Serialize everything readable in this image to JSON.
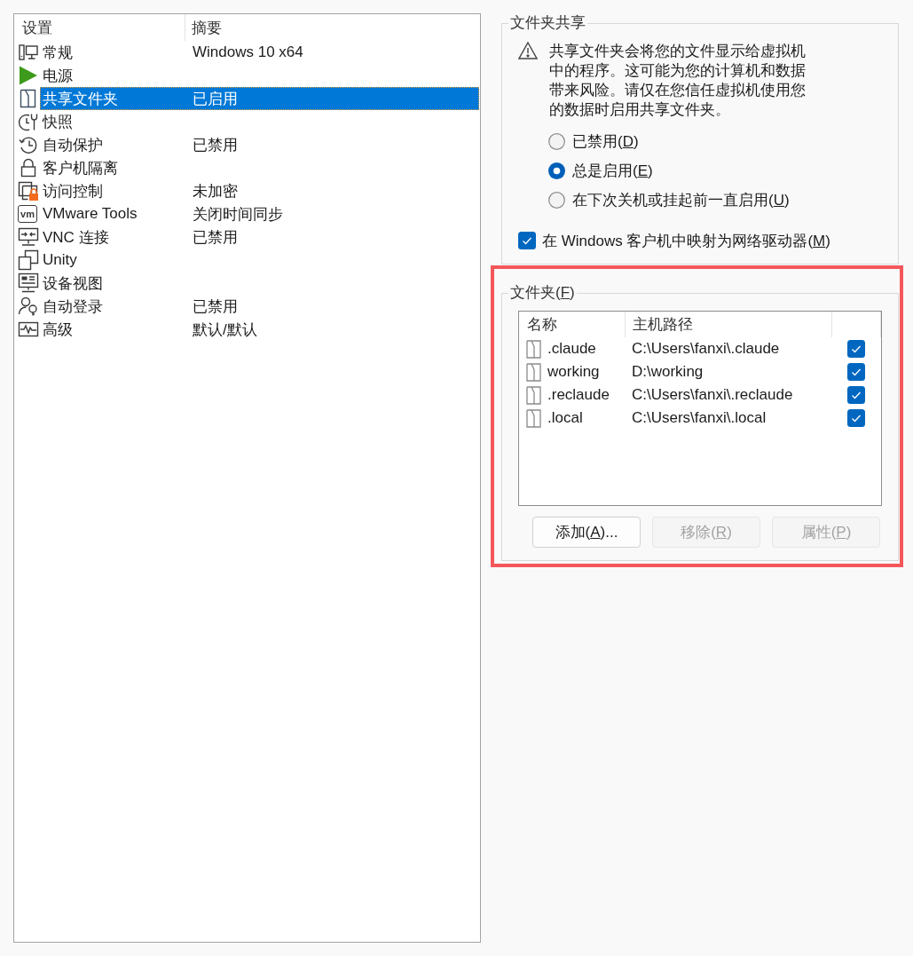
{
  "settings_list": {
    "columns": [
      "设置",
      "摘要"
    ],
    "items": [
      {
        "kind": "monitor",
        "name": "常规",
        "summary": "Windows 10 x64",
        "selected": false
      },
      {
        "kind": "play",
        "name": "电源",
        "selected": false
      },
      {
        "kind": "shared-folder",
        "name": "共享文件夹",
        "summary": "已启用",
        "selected": true
      },
      {
        "kind": "snapshot",
        "name": "快照",
        "selected": false
      },
      {
        "kind": "history",
        "name": "自动保护",
        "summary": "已禁用",
        "selected": false
      },
      {
        "kind": "padlock",
        "name": "客户机隔离",
        "selected": false
      },
      {
        "kind": "access-lock",
        "name": "访问控制",
        "summary": "未加密",
        "selected": false
      },
      {
        "kind": "badge",
        "badge": "vm",
        "name": "VMware Tools",
        "summary": "关闭时间同步",
        "selected": false
      },
      {
        "kind": "vnc",
        "name": "VNC 连接",
        "summary": "已禁用",
        "selected": false
      },
      {
        "kind": "unity",
        "name": "Unity",
        "selected": false
      },
      {
        "kind": "device-view",
        "name": "设备视图",
        "selected": false
      },
      {
        "kind": "auto-login",
        "name": "自动登录",
        "summary": "已禁用",
        "selected": false
      },
      {
        "kind": "advanced",
        "name": "高级",
        "summary": "默认/默认",
        "selected": false
      }
    ]
  },
  "sharing": {
    "title": "文件夹共享",
    "warning": "共享文件夹会将您的文件显示给虚拟机中的程序。这可能为您的计算机和数据带来风险。请仅在您信任虚拟机使用您的数据时启用共享文件夹。",
    "options": [
      {
        "label": {
          "before": "已禁用(",
          "key": "D",
          "after": ")"
        },
        "selected": false
      },
      {
        "label": {
          "before": "总是启用(",
          "key": "E",
          "after": ")"
        },
        "selected": true
      },
      {
        "label": {
          "before": "在下次关机或挂起前一直启用(",
          "key": "U",
          "after": ")"
        },
        "selected": false
      }
    ],
    "map_drive": {
      "label": {
        "before": "在 Windows 客户机中映射为网络驱动器(",
        "key": "M",
        "after": ")"
      },
      "checked": true
    }
  },
  "folders": {
    "highlighted": true,
    "title": {
      "before": "文件夹(",
      "key": "F",
      "after": ")"
    },
    "columns": [
      "名称",
      "主机路径"
    ],
    "rows": [
      {
        "name": ".claude",
        "path": "C:\\Users\\fanxi\\.claude",
        "checked": true
      },
      {
        "name": "working",
        "path": "D:\\working",
        "checked": true
      },
      {
        "name": ".reclaude",
        "path": "C:\\Users\\fanxi\\.reclaude",
        "checked": true
      },
      {
        "name": ".local",
        "path": "C:\\Users\\fanxi\\.local",
        "checked": true
      }
    ],
    "buttons": [
      {
        "label": {
          "before": "添加(",
          "key": "A",
          "after": ")..."
        },
        "disabled": false
      },
      {
        "label": {
          "before": "移除(",
          "key": "R",
          "after": ")"
        },
        "disabled": true
      },
      {
        "label": {
          "before": "属性(",
          "key": "P",
          "after": ")"
        },
        "disabled": true
      }
    ]
  }
}
